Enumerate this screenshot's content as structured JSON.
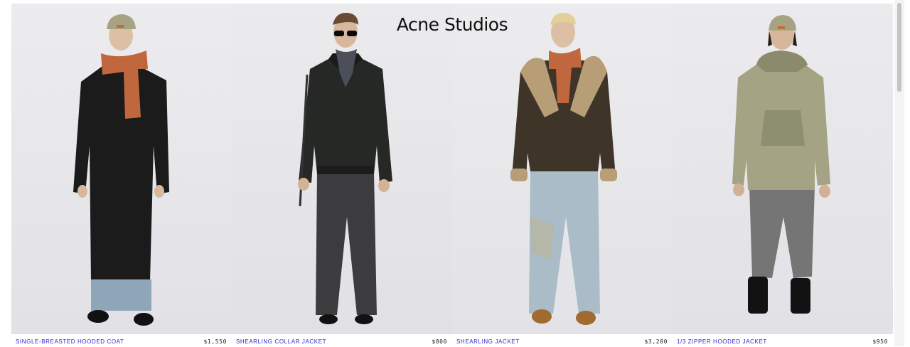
{
  "brand": {
    "logo_text": "Acne Studios"
  },
  "products": [
    {
      "name": "SINGLE-BREASTED HOODED COAT",
      "price": "$1,550",
      "image_alt": "Model in long black textured coat with orange knit scarf and beige cap"
    },
    {
      "name": "SHEARLING COLLAR JACKET",
      "price": "$800",
      "image_alt": "Model in black bomber jacket with sunglasses and grey trousers"
    },
    {
      "name": "SHEARLING JACKET",
      "price": "$3,200",
      "image_alt": "Model in brown leather shearling jacket with distressed light blue jeans"
    },
    {
      "name": "1/3 ZIPPER HOODED JACKET",
      "price": "$950",
      "image_alt": "Model in khaki hooded anorak with grey sweatpants and black boots"
    }
  ],
  "colors": {
    "link": "#2a2ad6",
    "photo_background": "#e9e9ec"
  }
}
